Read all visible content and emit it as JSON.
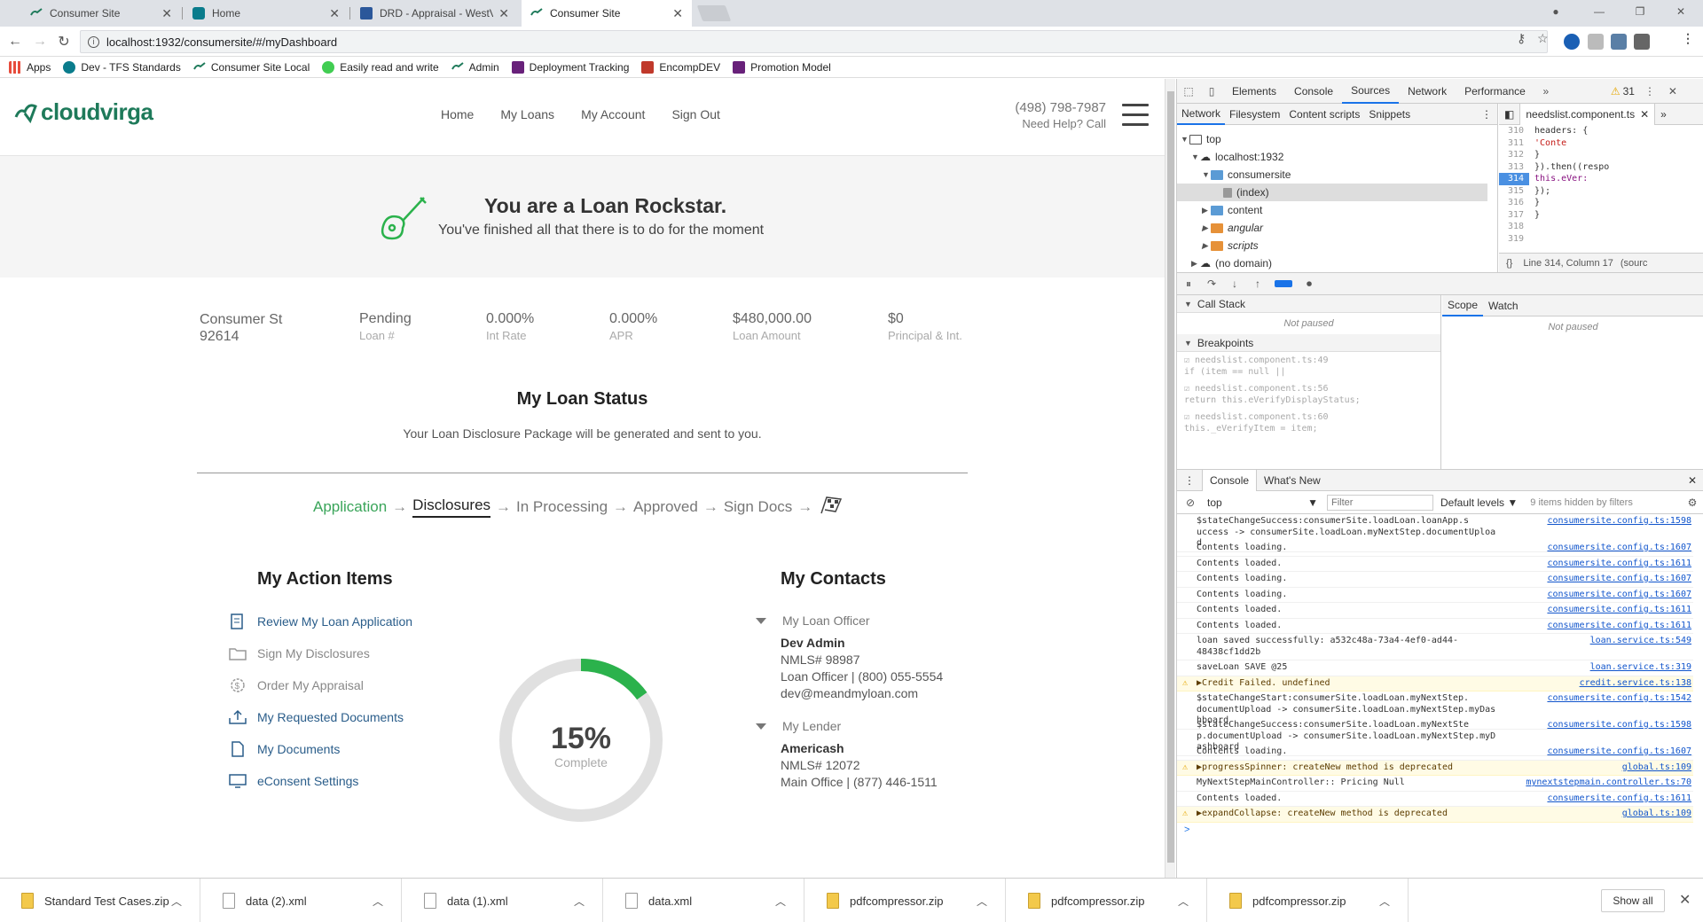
{
  "browser": {
    "tabs": [
      {
        "title": "Consumer Site",
        "icon": "cloudvirga-icon"
      },
      {
        "title": "Home",
        "icon": "sharepoint-icon"
      },
      {
        "title": "DRD - Appraisal - WestV",
        "icon": "word-icon"
      },
      {
        "title": "Consumer Site",
        "icon": "cloudvirga-icon",
        "active": true
      }
    ],
    "url": "localhost:1932/consumersite/#/myDashboard",
    "bookmarks": [
      {
        "label": "Apps",
        "icon": "apps-grid-icon"
      },
      {
        "label": "Dev - TFS Standards",
        "icon": "sharepoint-icon"
      },
      {
        "label": "Consumer Site Local",
        "icon": "cloudvirga-icon"
      },
      {
        "label": "Easily read and write",
        "icon": "qt-icon"
      },
      {
        "label": "Admin",
        "icon": "cloudvirga-icon"
      },
      {
        "label": "Deployment Tracking",
        "icon": "vs-icon"
      },
      {
        "label": "EncompDEV",
        "icon": "plus-icon"
      },
      {
        "label": "Promotion Model",
        "icon": "vs-icon"
      }
    ]
  },
  "site": {
    "logo": "cloudvirga",
    "nav": [
      "Home",
      "My Loans",
      "My Account",
      "Sign Out"
    ],
    "phone": "(498) 798-7987",
    "help": "Need Help? Call",
    "banner_title": "You are a Loan Rockstar.",
    "banner_sub": "You've finished all that there is to do for the moment",
    "summary": [
      {
        "value": "Consumer St\n92614",
        "label": ""
      },
      {
        "value": "Pending",
        "label": "Loan #"
      },
      {
        "value": "0.000%",
        "label": "Int Rate"
      },
      {
        "value": "0.000%",
        "label": "APR"
      },
      {
        "value": "$480,000.00",
        "label": "Loan Amount"
      },
      {
        "value": "$0",
        "label": "Principal & Int."
      }
    ],
    "status_title": "My Loan Status",
    "status_msg": "Your Loan Disclosure Package will be generated and sent to you.",
    "steps": [
      "Application",
      "Disclosures",
      "In Processing",
      "Approved",
      "Sign Docs"
    ],
    "actions_title": "My Action Items",
    "actions": [
      {
        "label": "Review My Loan Application",
        "state": "link",
        "icon": "document-icon"
      },
      {
        "label": "Sign My Disclosures",
        "state": "muted",
        "icon": "folder-icon"
      },
      {
        "label": "Order My Appraisal",
        "state": "muted",
        "icon": "dollar-gear-icon"
      },
      {
        "label": "My Requested Documents",
        "state": "link",
        "icon": "upload-tray-icon"
      },
      {
        "label": "My Documents",
        "state": "link",
        "icon": "page-icon"
      },
      {
        "label": "eConsent Settings",
        "state": "link",
        "icon": "monitor-icon"
      }
    ],
    "progress_pct": 15,
    "progress_label": "15%",
    "progress_sub": "Complete",
    "contacts_title": "My Contacts",
    "contacts": [
      {
        "group": "My Loan Officer",
        "name": "Dev Admin",
        "lines": [
          "NMLS# 98987",
          "Loan Officer | (800) 055-5554",
          "dev@meandmyloan.com"
        ]
      },
      {
        "group": "My Lender",
        "name": "Americash",
        "lines": [
          "NMLS# 12072",
          "Main Office | (877) 446-1511"
        ]
      }
    ],
    "colors": {
      "brand": "#1e7a5a",
      "progress": "#2bb24c",
      "link": "#2a5d8a"
    }
  },
  "devtools": {
    "tabs": [
      "Elements",
      "Console",
      "Sources",
      "Network",
      "Performance"
    ],
    "active_tab": "Sources",
    "warnings": "31",
    "nav_tabs": [
      "Network",
      "Filesystem",
      "Content scripts",
      "Snippets"
    ],
    "tree": [
      {
        "label": "top",
        "depth": 0
      },
      {
        "label": "localhost:1932",
        "depth": 1
      },
      {
        "label": "consumersite",
        "depth": 2
      },
      {
        "label": "(index)",
        "depth": 3
      },
      {
        "label": "content",
        "depth": 2
      },
      {
        "label": "angular",
        "depth": 2
      },
      {
        "label": "scripts",
        "depth": 2
      },
      {
        "label": "(no domain)",
        "depth": 1
      }
    ],
    "file_tab": "needslist.component.ts",
    "code": [
      {
        "n": "310",
        "t": "            headers: {"
      },
      {
        "n": "311",
        "t": "              'Conte"
      },
      {
        "n": "312",
        "t": "            }"
      },
      {
        "n": "313",
        "t": "          }).then((respo"
      },
      {
        "n": "314",
        "t": "            this.eVer:"
      },
      {
        "n": "315",
        "t": "          });"
      },
      {
        "n": "316",
        "t": "        }"
      },
      {
        "n": "317",
        "t": "      }"
      },
      {
        "n": "318",
        "t": ""
      },
      {
        "n": "319",
        "t": "      "
      }
    ],
    "cursor": "Line 314, Column 17",
    "cursor_src": "(sourc",
    "call_stack": "Call Stack",
    "not_paused": "Not paused",
    "breakpoints_title": "Breakpoints",
    "breakpoints": [
      {
        "file": "needslist.component.ts:49",
        "code": "if (item == null ||"
      },
      {
        "file": "needslist.component.ts:56",
        "code": "return this.eVerifyDisplayStatus;"
      },
      {
        "file": "needslist.component.ts:60",
        "code": "this._eVerifyItem = item;"
      }
    ],
    "scope_tabs": [
      "Scope",
      "Watch"
    ],
    "console_tabs": [
      "Console",
      "What's New"
    ],
    "context": "top",
    "filter_placeholder": "Filter",
    "levels": "Default levels",
    "hidden": "9 items hidden by filters",
    "logs": [
      {
        "msg": "$stateChangeSuccess:consumerSite.loadLoan.loanApp.s\nuccess -> consumerSite.loadLoan.myNextStep.documentUpload",
        "src": "consumersite.config.ts:1598"
      },
      {
        "msg": "Contents loading.",
        "src": "consumersite.config.ts:1607"
      },
      {
        "msg": "Contents loaded.",
        "src": "consumersite.config.ts:1611"
      },
      {
        "msg": "Contents loading.",
        "src": "consumersite.config.ts:1607"
      },
      {
        "msg": "Contents loading.",
        "src": "consumersite.config.ts:1607"
      },
      {
        "msg": "Contents loaded.",
        "src": "consumersite.config.ts:1611"
      },
      {
        "msg": "Contents loaded.",
        "src": "consumersite.config.ts:1611"
      },
      {
        "msg": "loan saved successfully: a532c48a-73a4-4ef0-ad44-\n48438cf1dd2b",
        "src": "loan.service.ts:549"
      },
      {
        "msg": "saveLoan SAVE @25",
        "src": "loan.service.ts:319"
      },
      {
        "msg": "▶Credit Failed. undefined",
        "src": "credit.service.ts:138",
        "warn": true
      },
      {
        "msg": "$stateChangeStart:consumerSite.loadLoan.myNextStep.\ndocumentUpload -> consumerSite.loadLoan.myNextStep.myDashboard",
        "src": "consumersite.config.ts:1542"
      },
      {
        "msg": "$stateChangeSuccess:consumerSite.loadLoan.myNextSte\np.documentUpload -> consumerSite.loadLoan.myNextStep.myDashboard",
        "src": "consumersite.config.ts:1598"
      },
      {
        "msg": "Contents loading.",
        "src": "consumersite.config.ts:1607"
      },
      {
        "msg": "▶progressSpinner: createNew method is deprecated",
        "src": "global.ts:109",
        "warn": true
      },
      {
        "msg": "MyNextStepMainController:: Pricing Null",
        "src": "mynextstepmain.controller.ts:70"
      },
      {
        "msg": "Contents loaded.",
        "src": "consumersite.config.ts:1611"
      },
      {
        "msg": "▶expandCollapse: createNew method is deprecated",
        "src": "global.ts:109",
        "warn": true
      }
    ],
    "prompt": ">"
  },
  "downloads": {
    "items": [
      {
        "name": "Standard Test Cases.zip",
        "type": "zip"
      },
      {
        "name": "data (2).xml",
        "type": "file"
      },
      {
        "name": "data (1).xml",
        "type": "file"
      },
      {
        "name": "data.xml",
        "type": "file"
      },
      {
        "name": "pdfcompressor.zip",
        "type": "zip"
      },
      {
        "name": "pdfcompressor.zip",
        "type": "zip"
      },
      {
        "name": "pdfcompressor.zip",
        "type": "zip"
      }
    ],
    "show_all": "Show all"
  }
}
